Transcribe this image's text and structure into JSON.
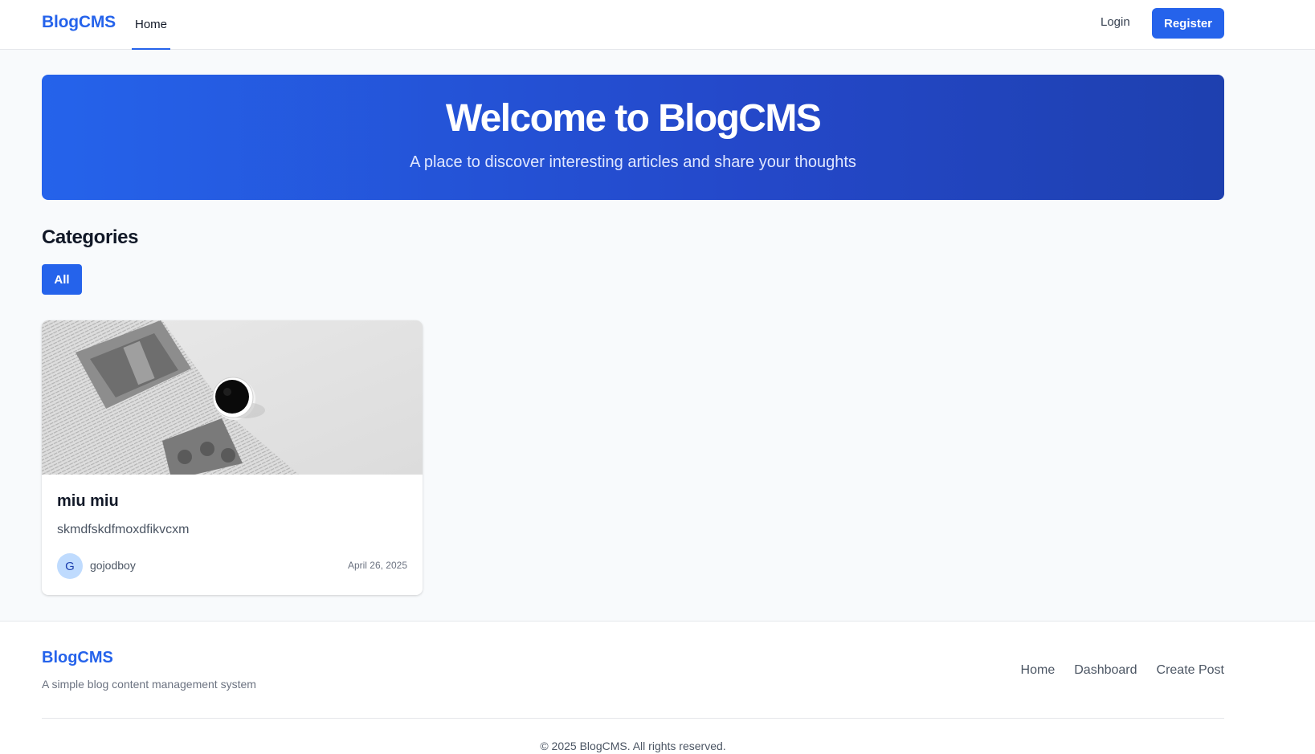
{
  "header": {
    "brand": "BlogCMS",
    "nav_home": "Home",
    "login": "Login",
    "register": "Register",
    "accent_color": "#2563eb"
  },
  "hero": {
    "title": "Welcome to BlogCMS",
    "subtitle": "A place to discover interesting articles and share your thoughts"
  },
  "categories": {
    "title": "Categories",
    "items": [
      "All"
    ],
    "selected": "All"
  },
  "posts": [
    {
      "image": "newspaper-coffee-image",
      "title": "miu miu",
      "excerpt": "skmdfskdfmoxdfikvcxm",
      "author_initial": "G",
      "author": "gojodboy",
      "date": "April 26, 2025"
    }
  ],
  "footer": {
    "brand": "BlogCMS",
    "tagline": "A simple blog content management system",
    "links": [
      "Home",
      "Dashboard",
      "Create Post"
    ],
    "copyright": "© 2025 BlogCMS. All rights reserved."
  }
}
